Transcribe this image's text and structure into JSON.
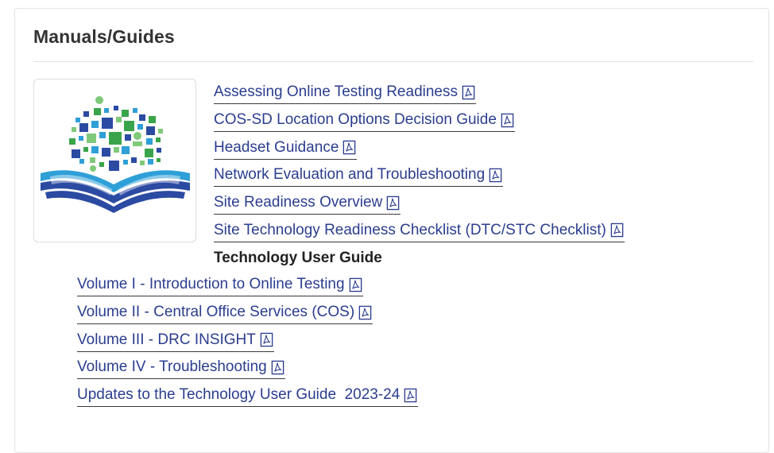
{
  "section": {
    "title": "Manuals/Guides"
  },
  "image": {
    "icon": "open-book-network-icon",
    "colors": {
      "blue": "#2b4aa2",
      "light_blue": "#2f9fd8",
      "green": "#3aa44a",
      "light_green": "#7fc97a"
    }
  },
  "links": [
    {
      "label": "Assessing Online Testing Readiness",
      "icon": "pdf-icon"
    },
    {
      "label": "COS-SD Location Options Decision Guide",
      "icon": "pdf-icon"
    },
    {
      "label": "Headset Guidance",
      "icon": "pdf-icon"
    },
    {
      "label": "Network Evaluation and Troubleshooting",
      "icon": "pdf-icon"
    },
    {
      "label": "Site Readiness Overview",
      "icon": "pdf-icon"
    },
    {
      "label": "Site Technology Readiness Checklist (DTC/STC Checklist)",
      "icon": "pdf-icon"
    }
  ],
  "user_guide": {
    "heading": "Technology User Guide",
    "volumes": [
      {
        "label": "Volume I - Introduction to Online Testing",
        "icon": "pdf-icon"
      },
      {
        "label": "Volume II - Central Office Services (COS)",
        "icon": "pdf-icon"
      },
      {
        "label": "Volume III - DRC INSIGHT",
        "icon": "pdf-icon"
      },
      {
        "label": "Volume IV - Troubleshooting",
        "icon": "pdf-icon"
      },
      {
        "label": "Updates to the Technology User Guide  2023-24",
        "icon": "pdf-icon"
      }
    ]
  },
  "colors": {
    "link": "#2b3d8f",
    "heading": "#333333",
    "border": "#e3e3e3"
  }
}
